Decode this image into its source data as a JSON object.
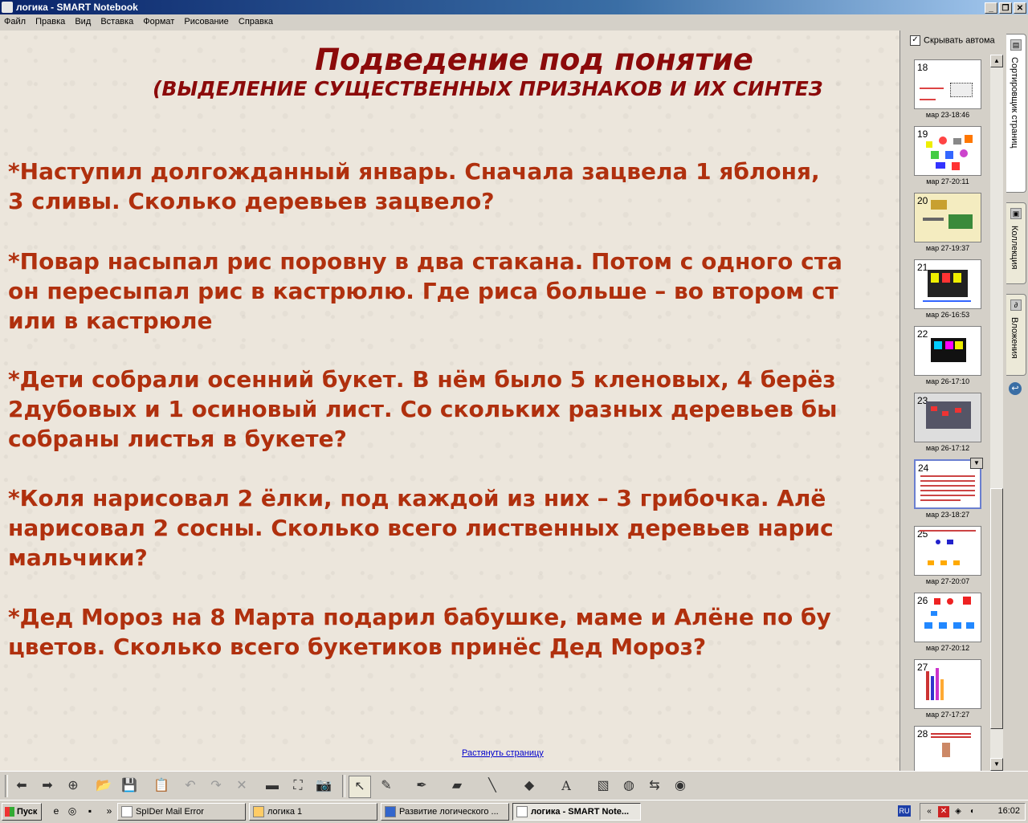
{
  "window": {
    "title": "логика - SMART Notebook"
  },
  "menu": [
    "Файл",
    "Правка",
    "Вид",
    "Вставка",
    "Формат",
    "Рисование",
    "Справка"
  ],
  "slide": {
    "title": "Подведение под понятие",
    "subtitle": "(ВЫДЕЛЕНИЕ СУЩЕСТВЕННЫХ ПРИЗНАКОВ И ИХ СИНТЕЗ",
    "problems": [
      {
        "lines": [
          "*Наступил долгожданный январь. Сначала зацвела 1 яблоня,",
          "3 сливы. Сколько деревьев зацвело?"
        ]
      },
      {
        "lines": [
          "*Повар насыпал рис поровну в два стакана. Потом с одного ста",
          "он пересыпал рис в кастрюлю. Где риса больше – во втором ст",
          "или в кастрюле"
        ]
      },
      {
        "lines": [
          "*Дети собрали осенний букет. В нём было 5 кленовых, 4 берёз",
          "2дубовых и 1 осиновый лист. Со скольких разных деревьев бы",
          "собраны листья в букете?"
        ]
      },
      {
        "lines": [
          "*Коля нарисовал 2 ёлки, под каждой из них – 3 грибочка. Алё",
          "нарисовал 2 сосны. Сколько всего лиственных деревьев нарис",
          "мальчики?"
        ]
      },
      {
        "lines": [
          "*Дед Мороз на 8 Марта подарил бабушке, маме и Алёне по бу",
          "цветов. Сколько всего букетиков принёс Дед Мороз?"
        ]
      }
    ],
    "stretch_link": "Растянуть страницу"
  },
  "sorter": {
    "autohide_label": "Скрывать автома",
    "autohide_checked": true,
    "pages": [
      {
        "num": "18",
        "date": "мар 23-18:46"
      },
      {
        "num": "19",
        "date": "мар 27-20:11"
      },
      {
        "num": "20",
        "date": "мар 27-19:37"
      },
      {
        "num": "21",
        "date": "мар 26-16:53"
      },
      {
        "num": "22",
        "date": "мар 26-17:10"
      },
      {
        "num": "23",
        "date": "мар 26-17:12"
      },
      {
        "num": "24",
        "date": "мар 23-18:27",
        "selected": true
      },
      {
        "num": "25",
        "date": "мар 27-20:07"
      },
      {
        "num": "26",
        "date": "мар 27-20:12"
      },
      {
        "num": "27",
        "date": "мар 27-17:27"
      },
      {
        "num": "28",
        "date": ""
      }
    ]
  },
  "side_tabs": [
    "Сортировщик страниц",
    "Коллекция",
    "Вложения"
  ],
  "taskbar": {
    "start": "Пуск",
    "tasks": [
      "SpIDer Mail Error",
      "логика 1",
      "Развитие логического ...",
      "логика - SMART Note..."
    ],
    "lang": "RU",
    "clock": "16:02"
  },
  "colors": {
    "slide_title": "#8b0a0a",
    "slide_text": "#b0300e",
    "link": "#0000cc"
  }
}
